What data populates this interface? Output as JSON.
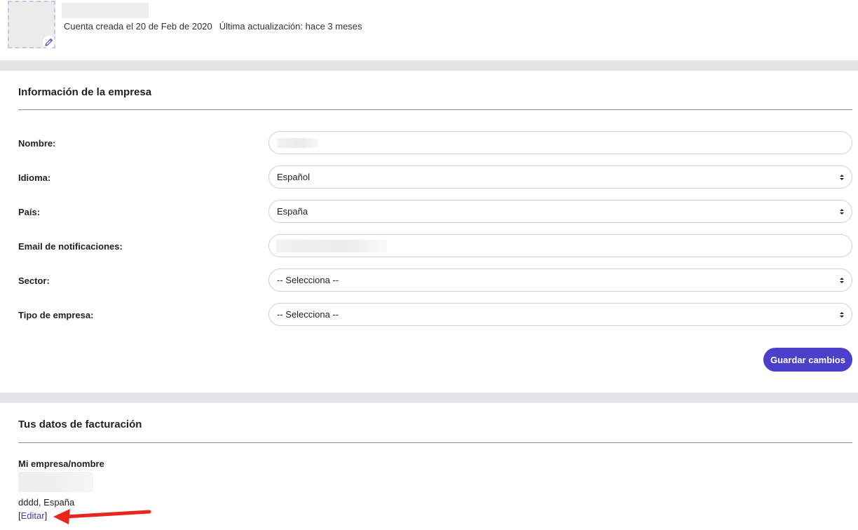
{
  "profile": {
    "created_label": "Cuenta creada el 20 de Feb de 2020",
    "updated_label": "Última actualización: hace 3 meses"
  },
  "company_section": {
    "title": "Información de la empresa",
    "fields": {
      "name_label": "Nombre:",
      "language_label": "Idioma:",
      "language_value": "Español",
      "country_label": "País:",
      "country_value": "España",
      "email_label": "Email de notificaciones:",
      "sector_label": "Sector:",
      "sector_value": "-- Selecciona --",
      "company_type_label": "Tipo de empresa:",
      "company_type_value": "-- Selecciona --"
    },
    "save_label": "Guardar cambios"
  },
  "billing_section": {
    "title": "Tus datos de facturación",
    "company_label": "Mi empresa/nombre",
    "address": "dddd, España",
    "bracket_open": "[",
    "edit_label": "Editar",
    "bracket_close": "]"
  },
  "colors": {
    "accent": "#4a40c9",
    "annotation_arrow": "#e8261e",
    "band": "#e4e5e8"
  }
}
